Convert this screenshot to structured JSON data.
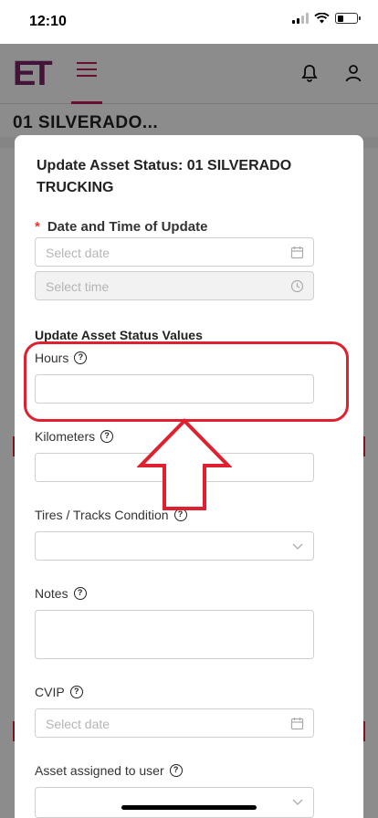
{
  "status_bar": {
    "time": "12:10"
  },
  "app": {
    "logo": "ET",
    "asset_title": "01 SILVERADO..."
  },
  "modal": {
    "title": "Update Asset Status: 01 SILVERADO TRUCKING",
    "date_time_label": "Date and Time of Update",
    "required_mark": "*",
    "date_placeholder": "Select date",
    "time_placeholder": "Select time",
    "section_title": "Update Asset Status Values",
    "fields": {
      "hours": {
        "label": "Hours",
        "value": ""
      },
      "kilometers": {
        "label": "Kilometers",
        "value": ""
      },
      "tires": {
        "label": "Tires / Tracks Condition",
        "value": ""
      },
      "notes": {
        "label": "Notes",
        "value": ""
      },
      "cvip": {
        "label": "CVIP",
        "placeholder": "Select date"
      },
      "assigned_user": {
        "label": "Asset assigned to user",
        "value": ""
      }
    },
    "help_glyph": "?"
  },
  "annotation": {
    "color": "#e0202f",
    "target": "Hours"
  },
  "colors": {
    "brand": "#7a2468",
    "accent": "#c2185b"
  }
}
